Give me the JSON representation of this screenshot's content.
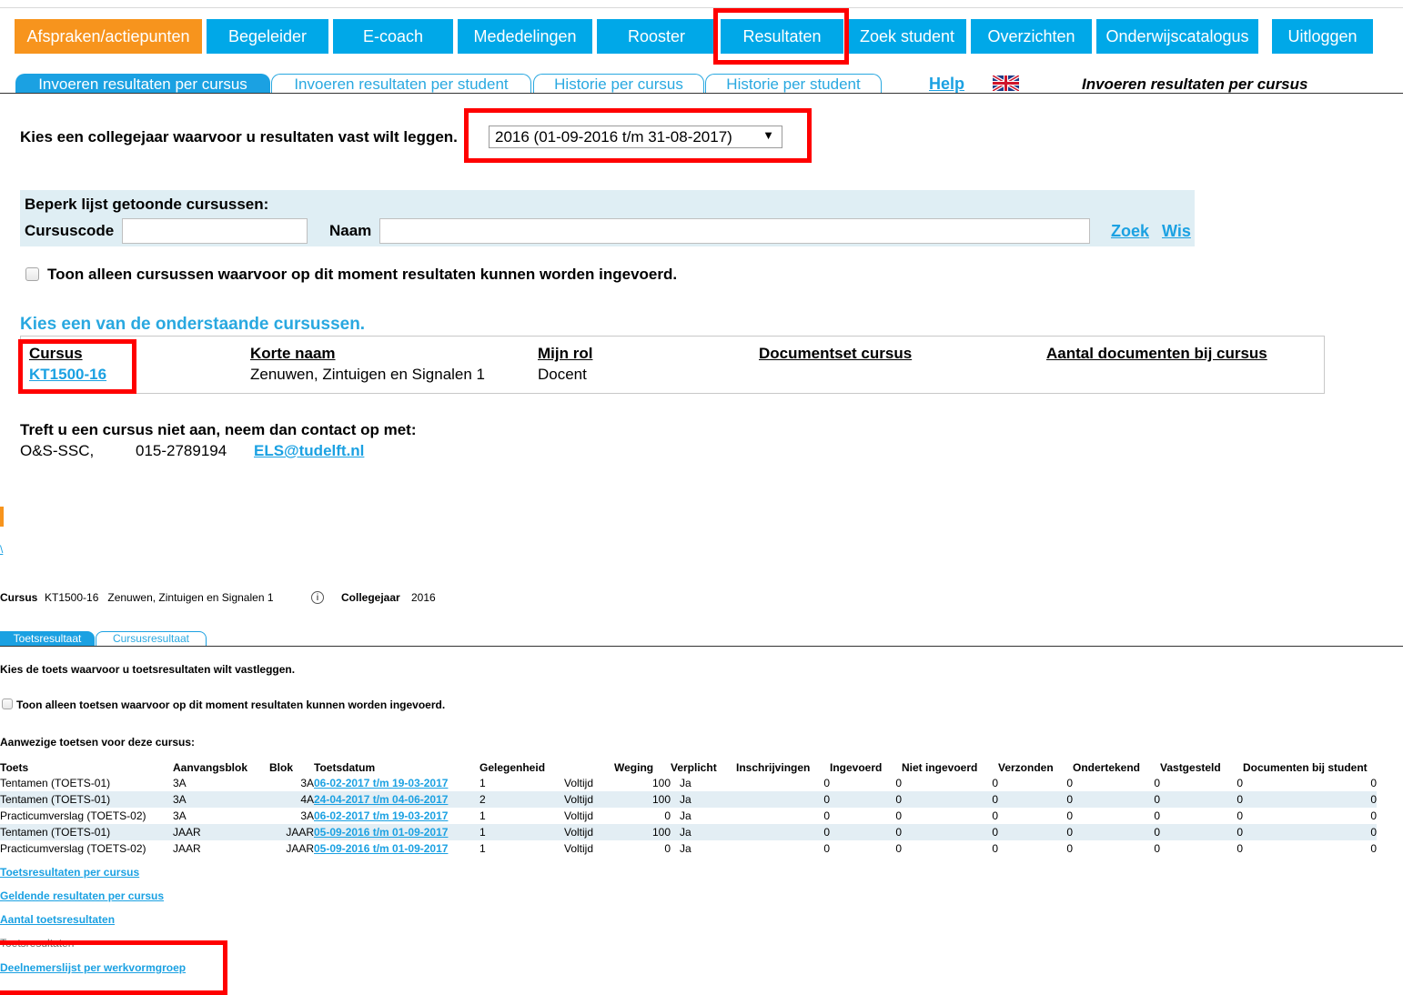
{
  "nav": {
    "items": [
      "Afspraken/actiepunten",
      "Begeleider",
      "E-coach",
      "Mededelingen",
      "Rooster",
      "Resultaten",
      "Zoek student",
      "Overzichten",
      "Onderwijscatalogus",
      "Uitloggen"
    ]
  },
  "tabs": [
    "Invoeren resultaten per cursus",
    "Invoeren resultaten per student",
    "Historie per cursus",
    "Historie per student"
  ],
  "help_label": "Help",
  "page_heading": "Invoeren resultaten per cursus",
  "year_prompt": "Kies een collegejaar waarvoor u resultaten vast wilt leggen.",
  "year_select_value": "2016 (01-09-2016 t/m 31-08-2017)",
  "filter": {
    "title": "Beperk lijst getoonde cursussen:",
    "code_label": "Cursuscode",
    "name_label": "Naam",
    "search_label": "Zoek",
    "clear_label": "Wis"
  },
  "only_open_label": "Toon alleen cursussen waarvoor op dit moment resultaten kunnen worden ingevoerd.",
  "choose_course": "Kies een van de onderstaande cursussen.",
  "course_table": {
    "headers": [
      "Cursus",
      "Korte naam",
      "Mijn rol",
      "Documentset cursus",
      "Aantal documenten bij cursus"
    ],
    "row": {
      "code": "KT1500-16",
      "name": "Zenuwen, Zintuigen en Signalen 1",
      "role": "Docent"
    }
  },
  "contact": {
    "prompt": "Treft u een cursus niet aan, neem dan contact op met:",
    "org": "O&S-SSC,",
    "phone": "015-2789194",
    "email": "ELS@tudelft.nl"
  },
  "lower": {
    "back_char": "\\",
    "course_label": "Cursus",
    "course_value": "KT1500-16   Zenuwen, Zintuigen en Signalen 1",
    "year_label": "Collegejaar",
    "year_value": "2016",
    "tabs": [
      "Toetsresultaat",
      "Cursusresultaat"
    ],
    "choose_test": "Kies de toets waarvoor u toetsresultaten wilt vastleggen.",
    "only_open_tests": "Toon alleen toetsen waarvoor op dit moment resultaten kunnen worden ingevoerd.",
    "present_tests": "Aanwezige toetsen voor deze cursus:",
    "table_headers": [
      "Toets",
      "Aanvangsblok",
      "Blok",
      "Toetsdatum",
      "Gelegenheid",
      "",
      "Weging",
      "Verplicht",
      "Inschrijvingen",
      "Ingevoerd",
      "Niet ingevoerd",
      "Verzonden",
      "Ondertekend",
      "Vastgesteld",
      "Documenten bij student"
    ],
    "rows": [
      [
        "Tentamen (TOETS-01)",
        "3A",
        "3A",
        "06-02-2017 t/m 19-03-2017",
        "1",
        "Voltijd",
        "100",
        "Ja",
        "0",
        "0",
        "0",
        "0",
        "0",
        "0",
        "0"
      ],
      [
        "Tentamen (TOETS-01)",
        "3A",
        "4A",
        "24-04-2017 t/m 04-06-2017",
        "2",
        "Voltijd",
        "100",
        "Ja",
        "0",
        "0",
        "0",
        "0",
        "0",
        "0",
        "0"
      ],
      [
        "Practicumverslag (TOETS-02)",
        "3A",
        "3A",
        "06-02-2017 t/m 19-03-2017",
        "1",
        "Voltijd",
        "0",
        "Ja",
        "0",
        "0",
        "0",
        "0",
        "0",
        "0",
        "0"
      ],
      [
        "Tentamen (TOETS-01)",
        "JAAR",
        "JAAR",
        "05-09-2016 t/m 01-09-2017",
        "1",
        "Voltijd",
        "100",
        "Ja",
        "0",
        "0",
        "0",
        "0",
        "0",
        "0",
        "0"
      ],
      [
        "Practicumverslag (TOETS-02)",
        "JAAR",
        "JAAR",
        "05-09-2016 t/m 01-09-2017",
        "1",
        "Voltijd",
        "0",
        "Ja",
        "0",
        "0",
        "0",
        "0",
        "0",
        "0",
        "0"
      ]
    ],
    "links": [
      "Toetsresultaten per cursus",
      "Geldende resultaten per cursus",
      "Aantal toetsresultaten",
      "Toetsresultaten",
      "Deelnemerslijst per werkvormgroep"
    ]
  },
  "colors": {
    "accent": "#00a8e8",
    "active": "#f7941d",
    "highlight": "#ff0000",
    "link": "#1ba1e2"
  }
}
